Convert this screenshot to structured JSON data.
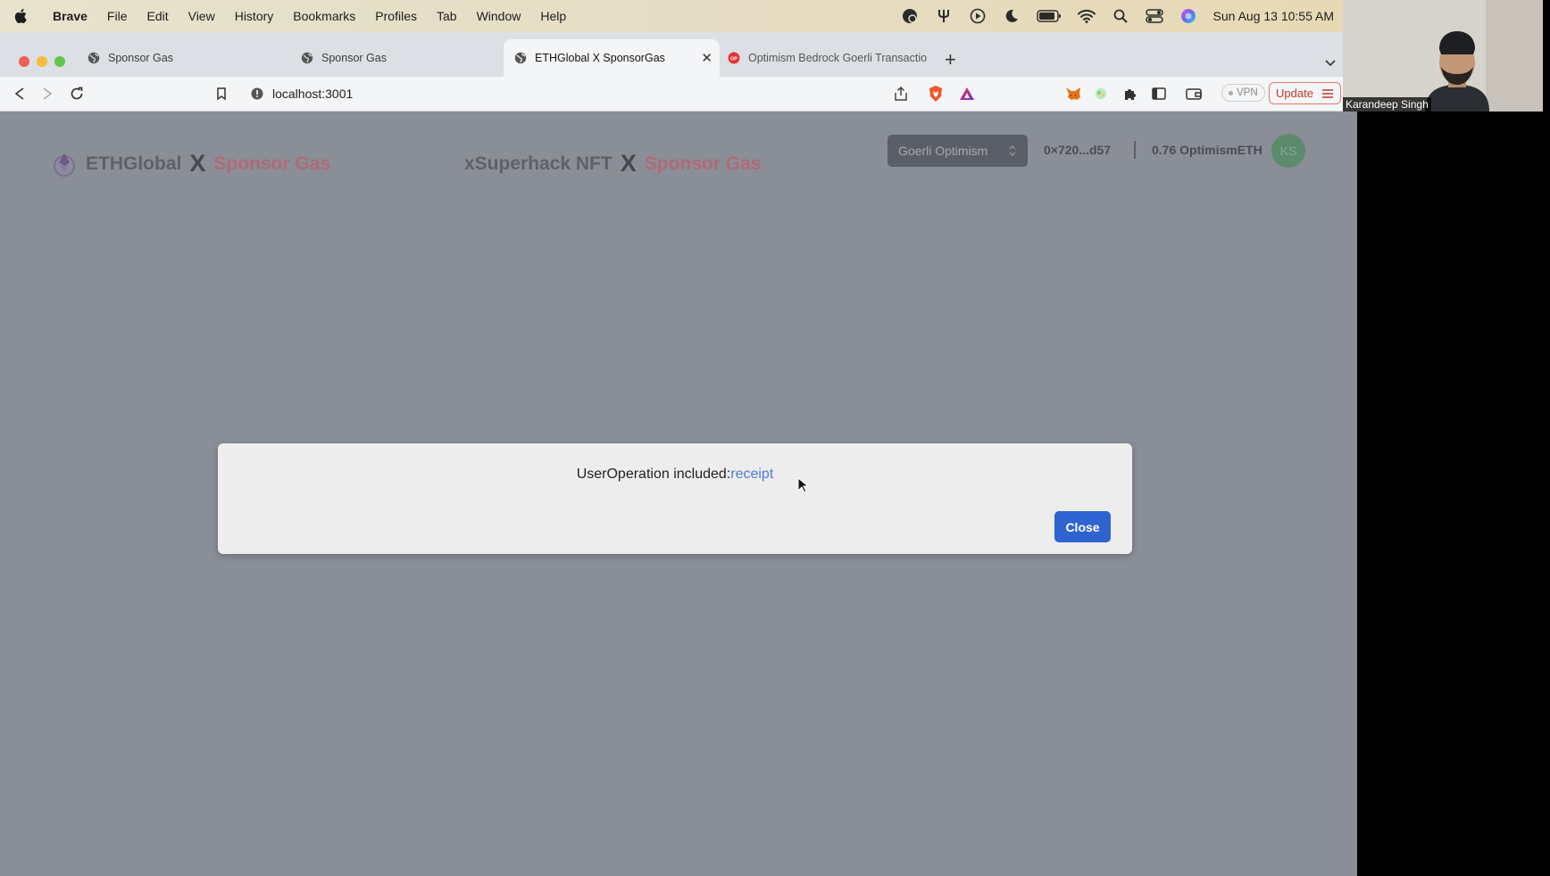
{
  "menubar": {
    "app": "Brave",
    "items": [
      "File",
      "Edit",
      "View",
      "History",
      "Bookmarks",
      "Profiles",
      "Tab",
      "Window",
      "Help"
    ],
    "datetime": "Sun Aug 13  10:55 AM"
  },
  "tabs": [
    {
      "title": "Sponsor Gas"
    },
    {
      "title": "Sponsor Gas"
    },
    {
      "title": "ETHGlobal X SponsorGas"
    },
    {
      "title": "Optimism Bedrock Goerli Transactio"
    }
  ],
  "toolbar": {
    "url": "localhost:3001",
    "vpn": "VPN",
    "update": "Update"
  },
  "page": {
    "left_brand": {
      "name": "ETHGlobal",
      "x": "X",
      "accent": "Sponsor Gas"
    },
    "center_brand": {
      "name": "xSuperhack NFT",
      "x": "X",
      "accent": "Sponsor Gas"
    },
    "network": "Goerli Optimism",
    "address": "0×720...d57",
    "balance": "0.76 OptimismETH",
    "avatar": "KS"
  },
  "modal": {
    "message": "UserOperation included:",
    "link": "receipt",
    "close": "Close"
  },
  "webcam": {
    "name": "Karandeep Singh"
  },
  "colors": {
    "page_overlay": "#8a8e96",
    "close_button": "#2f63cf",
    "link": "#4d79d6",
    "brand_accent": "#b06a77"
  }
}
